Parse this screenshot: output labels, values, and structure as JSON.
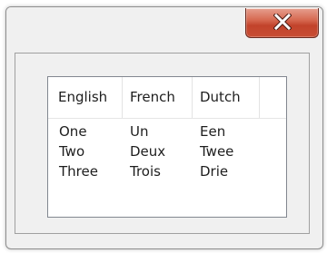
{
  "window": {
    "close_icon": "close-x-icon",
    "close_color": "#c2432b"
  },
  "listview": {
    "columns": [
      "English",
      "French",
      "Dutch"
    ],
    "rows": [
      [
        "One",
        "Un",
        "Een"
      ],
      [
        "Two",
        "Deux",
        "Twee"
      ],
      [
        "Three",
        "Trois",
        "Drie"
      ]
    ]
  }
}
